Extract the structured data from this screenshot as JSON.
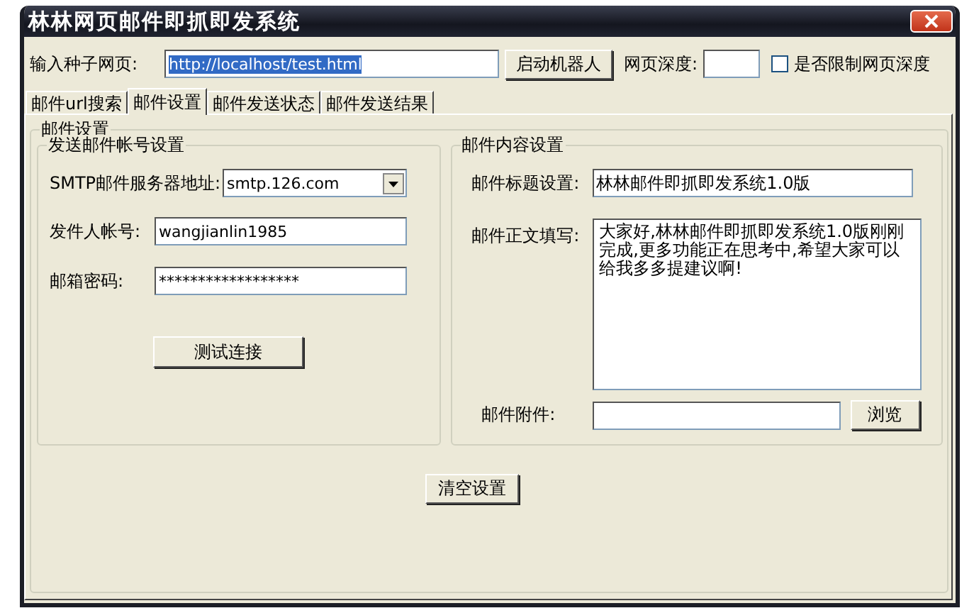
{
  "window": {
    "title": "林林网页邮件即抓即发系统"
  },
  "seed_url": {
    "label": "输入种子网页:",
    "value": "http://localhost/test.html",
    "text_selected": true
  },
  "start_button": "启动机器人",
  "depth": {
    "label": "网页深度:"
  },
  "limit_depth": {
    "label": "是否限制网页深度",
    "checked": false
  },
  "tabs": [
    {
      "label": "邮件url搜索",
      "selected": false
    },
    {
      "label": "邮件设置",
      "selected": true
    },
    {
      "label": "邮件发送状态",
      "selected": false
    },
    {
      "label": "邮件发送结果",
      "selected": false
    }
  ],
  "panel": {
    "title": "邮件设置",
    "account": {
      "title": "发送邮件帐号设置",
      "smtp": {
        "label": "SMTP邮件服务器地址:",
        "value": "smtp.126.com"
      },
      "sender": {
        "label": "发件人帐号:",
        "value": "wangjianlin1985"
      },
      "password": {
        "label": "邮箱密码:",
        "value": "******************"
      },
      "test_button": "测试连接"
    },
    "content": {
      "title": "邮件内容设置",
      "subject": {
        "label": "邮件标题设置:",
        "value": "林林邮件即抓即发系统1.0版"
      },
      "body": {
        "label": "邮件正文填写:",
        "value": "大家好,林林邮件即抓即发系统1.0版刚刚完成,更多功能正在思考中,希望大家可以给我多多提建议啊!"
      },
      "attachment": {
        "label": "邮件附件:"
      },
      "browse_button": "浏览"
    },
    "clear_button": "清空设置"
  }
}
